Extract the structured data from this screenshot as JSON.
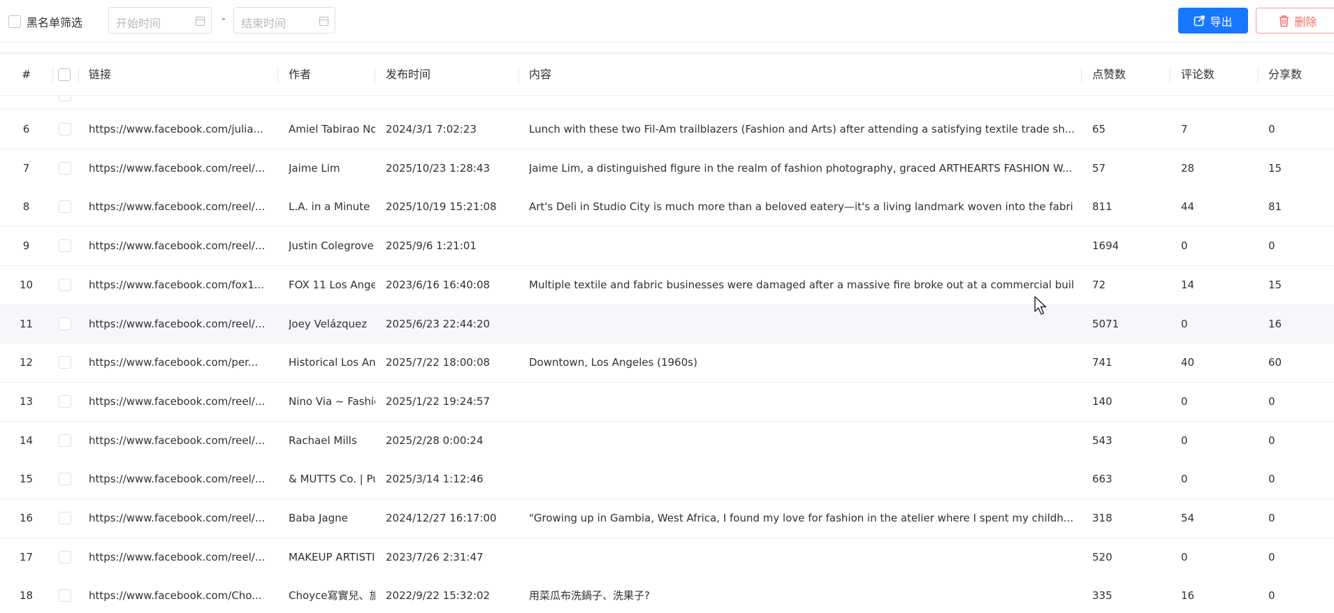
{
  "toolbar": {
    "blacklist_label": "黑名单筛选",
    "start_placeholder": "开始时间",
    "end_placeholder": "结束时间",
    "range_separator": "-",
    "export_label": "导出",
    "delete_label": "删除"
  },
  "table": {
    "columns": {
      "index": "#",
      "link": "链接",
      "author": "作者",
      "published": "发布时间",
      "content": "内容",
      "likes": "点赞数",
      "comments": "评论数",
      "shares": "分享数"
    },
    "rows": [
      {
        "index": "6",
        "link": "https://www.facebook.com/julia...",
        "author": "Amiel Tabirao Nc",
        "published": "2024/3/1 7:02:23",
        "content": "Lunch with these two Fil-Am trailblazers (Fashion and Arts) after attending a  satisfying textile trade sh...",
        "likes": "65",
        "comments": "7",
        "shares": "0"
      },
      {
        "index": "7",
        "link": "https://www.facebook.com/reel/...",
        "author": "Jaime Lim",
        "published": "2025/10/23 1:28:43",
        "content": "Jaime Lim, a distinguished figure in the realm of fashion photography, graced ARTHEARTS FASHION W...",
        "likes": "57",
        "comments": "28",
        "shares": "15"
      },
      {
        "index": "8",
        "link": "https://www.facebook.com/reel/...",
        "author": "L.A. in a Minute",
        "published": "2025/10/19 15:21:08",
        "content": "Art's Deli in Studio City is much more than a beloved eatery—it's a living landmark woven into the fabri...",
        "likes": "811",
        "comments": "44",
        "shares": "81"
      },
      {
        "index": "9",
        "link": "https://www.facebook.com/reel/...",
        "author": "Justin Colegrove",
        "published": "2025/9/6 1:21:01",
        "content": "",
        "likes": "1694",
        "comments": "0",
        "shares": "0"
      },
      {
        "index": "10",
        "link": "https://www.facebook.com/fox1...",
        "author": "FOX 11 Los Ange",
        "published": "2023/6/16 16:40:08",
        "content": "Multiple textile and fabric businesses were damaged after a massive fire broke out at a commercial buil...",
        "likes": "72",
        "comments": "14",
        "shares": "15"
      },
      {
        "index": "11",
        "link": "https://www.facebook.com/reel/...",
        "author": "Joey Velázquez",
        "published": "2025/6/23 22:44:20",
        "content": "",
        "likes": "5071",
        "comments": "0",
        "shares": "16"
      },
      {
        "index": "12",
        "link": "https://www.facebook.com/per...",
        "author": "Historical Los An",
        "published": "2025/7/22 18:00:08",
        "content": "Downtown, Los Angeles (1960s)",
        "likes": "741",
        "comments": "40",
        "shares": "60"
      },
      {
        "index": "13",
        "link": "https://www.facebook.com/reel/...",
        "author": "Nino Via ~ Fashic",
        "published": "2025/1/22 19:24:57",
        "content": "",
        "likes": "140",
        "comments": "0",
        "shares": "0"
      },
      {
        "index": "14",
        "link": "https://www.facebook.com/reel/...",
        "author": "Rachael Mills",
        "published": "2025/2/28 0:00:24",
        "content": "",
        "likes": "543",
        "comments": "0",
        "shares": "0"
      },
      {
        "index": "15",
        "link": "https://www.facebook.com/reel/...",
        "author": "& MUTTS Co. | Pu",
        "published": "2025/3/14 1:12:46",
        "content": "",
        "likes": "663",
        "comments": "0",
        "shares": "0"
      },
      {
        "index": "16",
        "link": "https://www.facebook.com/reel/...",
        "author": "Baba Jagne",
        "published": "2024/12/27 16:17:00",
        "content": "\"Growing up in Gambia, West Africa, I found my love for fashion in the atelier where I spent my childh...",
        "likes": "318",
        "comments": "54",
        "shares": "0"
      },
      {
        "index": "17",
        "link": "https://www.facebook.com/reel/...",
        "author": "MAKEUP ARTISTI",
        "published": "2023/7/26 2:31:47",
        "content": "",
        "likes": "520",
        "comments": "0",
        "shares": "0"
      },
      {
        "index": "18",
        "link": "https://www.facebook.com/Cho...",
        "author": "Choyce寫實兒、旅",
        "published": "2022/9/22 15:32:02",
        "content": "用菜瓜布洗鍋子、洗果子?",
        "likes": "335",
        "comments": "16",
        "shares": "0"
      }
    ]
  },
  "colors": {
    "primary": "#1677ff",
    "danger": "#f56c6c",
    "row_hover": "#f5f7fa",
    "border": "#ebeef5"
  },
  "icons": {
    "export": "share-box-icon",
    "delete": "trash-icon",
    "date": "calendar-icon",
    "cursor": "mouse-pointer-icon"
  }
}
